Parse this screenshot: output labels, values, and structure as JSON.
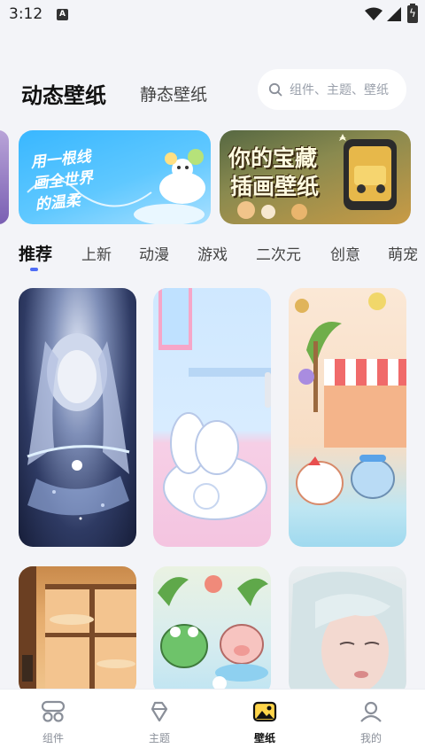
{
  "status_bar": {
    "time": "3:12",
    "notification": "A"
  },
  "header": {
    "tab_active": "动态壁纸",
    "tab_inactive": "静态壁纸",
    "search_placeholder": "组件、主题、壁纸"
  },
  "banners": [
    {
      "title_lines": [
        "用一根线",
        "画全世界",
        "的温柔"
      ]
    },
    {
      "title_lines": [
        "你的宝藏",
        "插画壁纸"
      ]
    }
  ],
  "categories": [
    "推荐",
    "上新",
    "动漫",
    "游戏",
    "二次元",
    "创意",
    "萌宠"
  ],
  "wallpapers": [
    {
      "subject": "fantasy-woman-ice"
    },
    {
      "subject": "white-bunny-pink"
    },
    {
      "subject": "cute-beach-animals"
    },
    {
      "subject": "window-sunset"
    },
    {
      "subject": "frog-pig-beach"
    },
    {
      "subject": "silver-hair-girl"
    }
  ],
  "bottom_nav": [
    {
      "label": "组件",
      "icon": "widget-icon"
    },
    {
      "label": "主题",
      "icon": "theme-icon"
    },
    {
      "label": "壁纸",
      "icon": "wallpaper-icon"
    },
    {
      "label": "我的",
      "icon": "profile-icon"
    }
  ],
  "colors": {
    "accent": "#4e6cf5",
    "background": "#f3f4f8"
  }
}
